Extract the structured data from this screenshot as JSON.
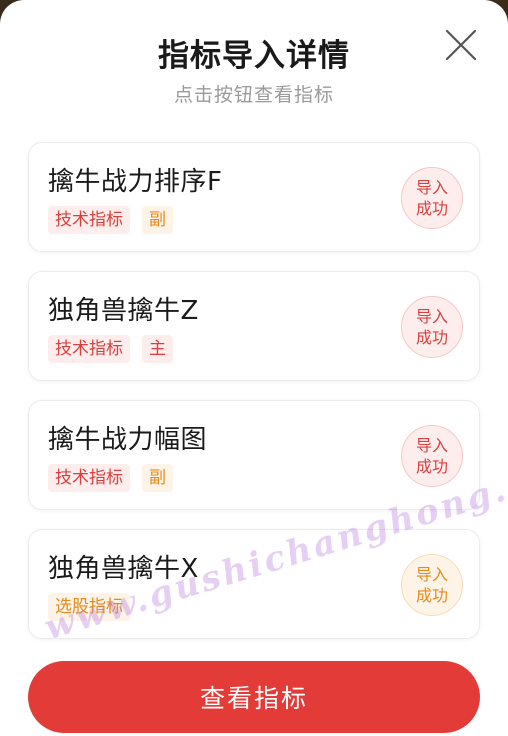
{
  "modal": {
    "title": "指标导入详情",
    "subtitle": "点击按钮查看指标"
  },
  "items": [
    {
      "name": "擒牛战力排序F",
      "tags": [
        {
          "text": "技术指标",
          "color": "red"
        },
        {
          "text": "副",
          "color": "orange"
        }
      ],
      "stamp": {
        "line1": "导入",
        "line2": "成功",
        "color": "red"
      }
    },
    {
      "name": "独角兽擒牛Z",
      "tags": [
        {
          "text": "技术指标",
          "color": "red"
        },
        {
          "text": "主",
          "color": "red"
        }
      ],
      "stamp": {
        "line1": "导入",
        "line2": "成功",
        "color": "red"
      }
    },
    {
      "name": "擒牛战力幅图",
      "tags": [
        {
          "text": "技术指标",
          "color": "red"
        },
        {
          "text": "副",
          "color": "orange"
        }
      ],
      "stamp": {
        "line1": "导入",
        "line2": "成功",
        "color": "red"
      }
    },
    {
      "name": "独角兽擒牛X",
      "tags": [
        {
          "text": "选股指标",
          "color": "orange"
        }
      ],
      "stamp": {
        "line1": "导入",
        "line2": "成功",
        "color": "orange"
      }
    }
  ],
  "button": {
    "label": "查看指标"
  },
  "watermark": "www.gushichanghong.com",
  "colors": {
    "primary_red": "#e33b37",
    "tag_red": "#d8403e",
    "tag_orange": "#e58a1f"
  },
  "icons": {
    "close": "close-icon"
  }
}
